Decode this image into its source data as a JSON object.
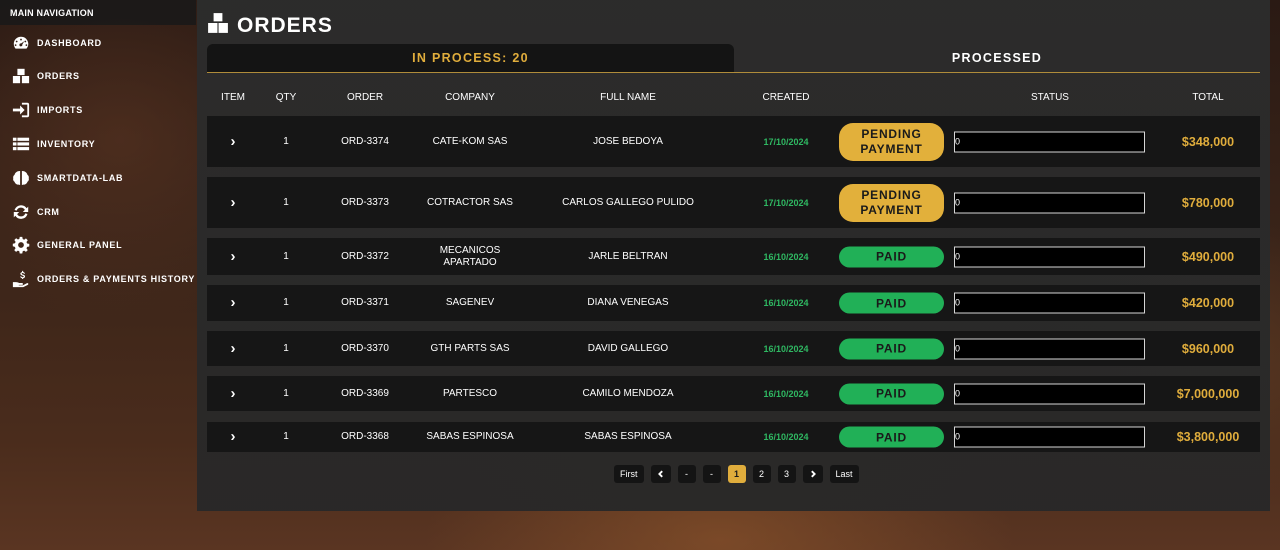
{
  "sidebar": {
    "header": "MAIN NAVIGATION",
    "items": [
      {
        "label": "DASHBOARD",
        "icon": "gauge-icon"
      },
      {
        "label": "ORDERS",
        "icon": "boxes-icon"
      },
      {
        "label": "IMPORTS",
        "icon": "sign-in-icon"
      },
      {
        "label": "INVENTORY",
        "icon": "list-icon"
      },
      {
        "label": "SMARTDATA-LAB",
        "icon": "brain-icon"
      },
      {
        "label": "CRM",
        "icon": "sync-icon"
      },
      {
        "label": "GENERAL PANEL",
        "icon": "gear-icon"
      },
      {
        "label": "ORDERS & PAYMENTS HISTORY",
        "icon": "hand-dollar-icon"
      }
    ]
  },
  "page": {
    "title": "ORDERS",
    "tabs": {
      "in_process": "IN PROCESS: 20",
      "processed": "PROCESSED"
    }
  },
  "table": {
    "headers": {
      "item": "ITEM",
      "qty": "QTY",
      "order": "ORDER",
      "company": "COMPANY",
      "full_name": "FULL NAME",
      "created": "CREATED",
      "status": "STATUS",
      "total": "TOTAL"
    },
    "rows": [
      {
        "qty": "1",
        "order": "ORD-3374",
        "company": "CATE-KOM SAS",
        "full_name": "JOSE BEDOYA",
        "created": "17/10/2024",
        "status": "PENDING PAYMENT",
        "progress": "0",
        "total": "$348,000"
      },
      {
        "qty": "1",
        "order": "ORD-3373",
        "company": "COTRACTOR SAS",
        "full_name": "CARLOS GALLEGO PULIDO",
        "created": "17/10/2024",
        "status": "PENDING PAYMENT",
        "progress": "0",
        "total": "$780,000"
      },
      {
        "qty": "1",
        "order": "ORD-3372",
        "company": "MECANICOS APARTADO",
        "full_name": "JARLE BELTRAN",
        "created": "16/10/2024",
        "status": "PAID",
        "progress": "0",
        "total": "$490,000"
      },
      {
        "qty": "1",
        "order": "ORD-3371",
        "company": "SAGENEV",
        "full_name": "DIANA VENEGAS",
        "created": "16/10/2024",
        "status": "PAID",
        "progress": "0",
        "total": "$420,000"
      },
      {
        "qty": "1",
        "order": "ORD-3370",
        "company": "GTH PARTS SAS",
        "full_name": "DAVID GALLEGO",
        "created": "16/10/2024",
        "status": "PAID",
        "progress": "0",
        "total": "$960,000"
      },
      {
        "qty": "1",
        "order": "ORD-3369",
        "company": "PARTESCO",
        "full_name": "CAMILO MENDOZA",
        "created": "16/10/2024",
        "status": "PAID",
        "progress": "0",
        "total": "$7,000,000"
      },
      {
        "qty": "1",
        "order": "ORD-3368",
        "company": "SABAS ESPINOSA",
        "full_name": "SABAS ESPINOSA",
        "created": "16/10/2024",
        "status": "PAID",
        "progress": "0",
        "total": "$3,800,000"
      }
    ]
  },
  "pagination": {
    "first": "First",
    "ellipsis_left": "-",
    "ellipsis_right": "-",
    "pages": [
      "1",
      "2",
      "3"
    ],
    "current": "1",
    "last": "Last"
  },
  "colors": {
    "accent_gold": "#e0ad3c",
    "paid_green": "#21b057",
    "pending_gold": "#e2b03b",
    "date_green": "#2fb862"
  }
}
